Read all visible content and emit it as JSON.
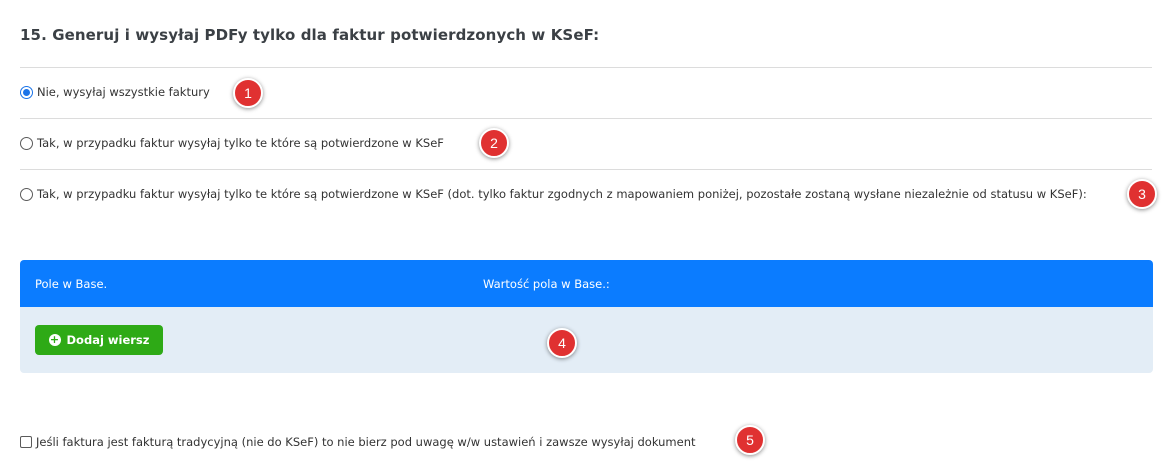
{
  "section": {
    "title": "15. Generuj i wysyłaj PDFy tylko dla faktur potwierdzonych w KSeF:"
  },
  "options": [
    {
      "label": "Nie, wysyłaj wszystkie faktury",
      "checked": true,
      "badge": "1"
    },
    {
      "label": "Tak, w przypadku faktur wysyłaj tylko te które są potwierdzone w KSeF",
      "checked": false,
      "badge": "2"
    },
    {
      "label": "Tak, w przypadku faktur wysyłaj tylko te które są potwierdzone w KSeF (dot. tylko faktur zgodnych z mapowaniem poniżej, pozostałe zostaną wysłane niezależnie od statusu w KSeF):",
      "checked": false,
      "badge": "3"
    }
  ],
  "mapping_table": {
    "columns": [
      "Pole w Base.",
      "Wartość pola w Base.:"
    ],
    "add_row_label": "Dodaj wiersz",
    "badge": "4"
  },
  "traditional_invoice": {
    "label": "Jeśli faktura jest fakturą tradycyjną (nie do KSeF) to nie bierz pod uwagę w/w ustawień i zawsze wysyłaj dokument",
    "checked": false,
    "badge": "5"
  },
  "colors": {
    "header_blue": "#0b7cff",
    "button_green": "#2eaa16",
    "badge_red": "#e03131",
    "table_body": "#e3edf6"
  }
}
